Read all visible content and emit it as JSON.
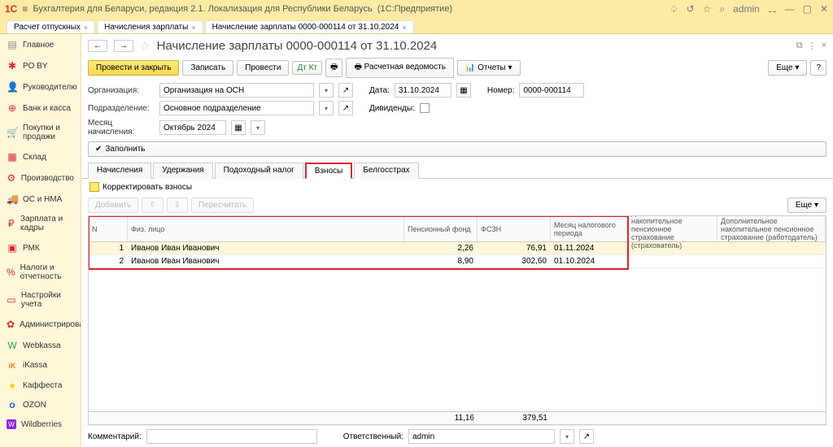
{
  "titlebar": {
    "app_title": "Бухгалтерия для Беларуси, редакция 2.1. Локализация для Республики Беларусь",
    "mode": "(1С:Предприятие)",
    "user": "admin"
  },
  "tabs": [
    {
      "label": "Расчет отпускных"
    },
    {
      "label": "Начисления зарплаты"
    },
    {
      "label": "Начисление зарплаты 0000-000114 от 31.10.2024"
    }
  ],
  "sidebar": {
    "items": [
      {
        "icon": "▤",
        "label": "Главное",
        "color": "#888"
      },
      {
        "icon": "✱",
        "label": "PO BY",
        "color": "#d9272e"
      },
      {
        "icon": "👤",
        "label": "Руководителю",
        "color": "#d9272e"
      },
      {
        "icon": "⊕",
        "label": "Банк и касса",
        "color": "#d9272e"
      },
      {
        "icon": "🛒",
        "label": "Покупки и продажи",
        "color": "#d9272e"
      },
      {
        "icon": "▦",
        "label": "Склад",
        "color": "#d9272e"
      },
      {
        "icon": "⚙",
        "label": "Производство",
        "color": "#d9272e"
      },
      {
        "icon": "🚚",
        "label": "ОС и НМА",
        "color": "#d9272e"
      },
      {
        "icon": "₽",
        "label": "Зарплата и кадры",
        "color": "#d9272e"
      },
      {
        "icon": "▣",
        "label": "РМК",
        "color": "#d9272e"
      },
      {
        "icon": "%",
        "label": "Налоги и отчетность",
        "color": "#d9272e"
      },
      {
        "icon": "▭",
        "label": "Настройки учета",
        "color": "#d9272e"
      },
      {
        "icon": "✿",
        "label": "Администрирование",
        "color": "#d9272e"
      },
      {
        "icon": "W",
        "label": "Webkassa",
        "color": "#2a9d5a"
      },
      {
        "icon": "iK",
        "label": "iKassa",
        "color": "#e67d22"
      },
      {
        "icon": "●",
        "label": "Каффеста",
        "color": "#ffd400"
      },
      {
        "icon": "O",
        "label": "OZON",
        "color": "#0050e0"
      },
      {
        "icon": "W",
        "label": "Wildberries",
        "color": "#8a2be2"
      }
    ]
  },
  "doc": {
    "title": "Начисление зарплаты 0000-000114 от 31.10.2024",
    "buttons": {
      "post_close": "Провести и закрыть",
      "save": "Записать",
      "post": "Провести",
      "payroll": "Расчетная ведомость",
      "reports": "Отчеты",
      "more": "Еще",
      "help": "?"
    },
    "fields": {
      "org_label": "Организация:",
      "org_value": "Организация на ОСН",
      "date_label": "Дата:",
      "date_value": "31.10.2024",
      "num_label": "Номер:",
      "num_value": "0000-000114",
      "dept_label": "Подразделение:",
      "dept_value": "Основное подразделение",
      "div_label": "Дивиденды:",
      "month_label": "Месяц начисления:",
      "month_value": "Октябрь 2024",
      "fill": "Заполнить"
    },
    "sub_tabs": [
      "Начисления",
      "Удержания",
      "Подоходный налог",
      "Взносы",
      "Белгосстрах"
    ],
    "active_sub_tab": 3,
    "correct_label": "Корректировать взносы",
    "sub_toolbar": {
      "add": "Добавить",
      "recalc": "Пересчитать",
      "more": "Еще"
    },
    "grid": {
      "cols": [
        "N",
        "Физ. лицо",
        "Пенсионный фонд",
        "ФСЗН",
        "Месяц налогового периода",
        "Дополнительное накопительное пенсионное страхование (страхователь)",
        "Дополнительное накопительное пенсионное страхование (работодатель)"
      ],
      "rows": [
        {
          "n": "1",
          "name": "Иванов Иван Иванович",
          "pf": "2,26",
          "fszn": "76,91",
          "period": "01.11.2024"
        },
        {
          "n": "2",
          "name": "Иванов Иван Иванович",
          "pf": "8,90",
          "fszn": "302,60",
          "period": "01.10.2024"
        }
      ],
      "totals": {
        "pf": "11,16",
        "fszn": "379,51"
      }
    },
    "footer": {
      "comment_label": "Комментарий:",
      "resp_label": "Ответственный:",
      "resp_value": "admin"
    }
  }
}
